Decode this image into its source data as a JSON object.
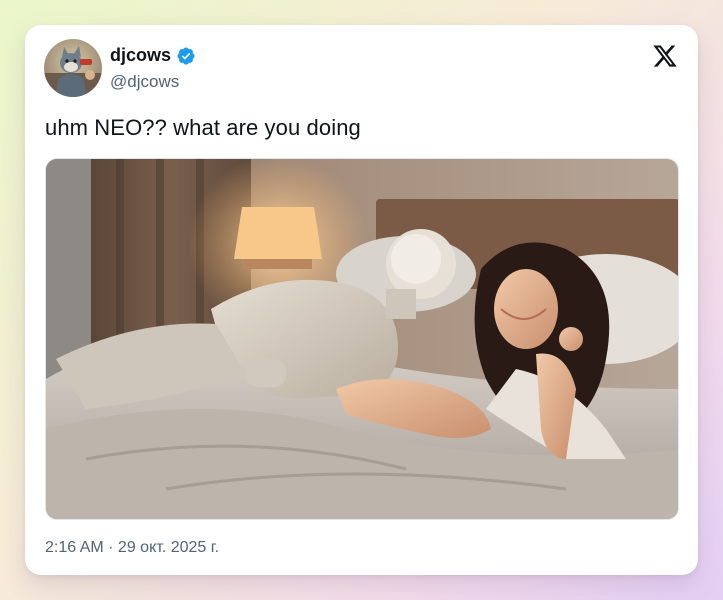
{
  "tweet": {
    "display_name": "djcows",
    "handle": "@djcows",
    "verified": true,
    "text": "uhm NEO?? what are you doing",
    "timestamp": "2:16 AM · 29 окт. 2025 г."
  },
  "icons": {
    "verified": "verified-badge-icon",
    "brand": "x-logo-icon"
  },
  "colors": {
    "verified_blue": "#1d9bf0",
    "text_primary": "#0f1419",
    "text_secondary": "#536471"
  }
}
